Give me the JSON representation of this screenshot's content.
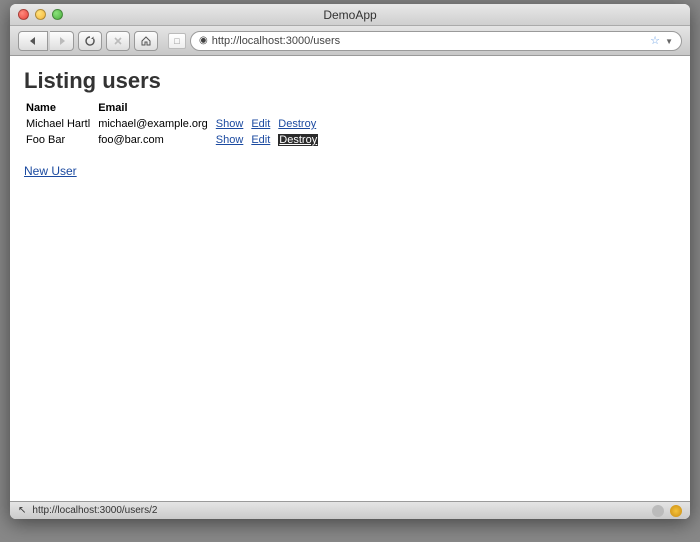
{
  "window": {
    "title": "DemoApp"
  },
  "toolbar": {
    "address": "http://localhost:3000/users"
  },
  "page": {
    "heading": "Listing users",
    "columns": {
      "name": "Name",
      "email": "Email"
    },
    "rows": [
      {
        "name": "Michael Hartl",
        "email": "michael@example.org",
        "show": "Show",
        "edit": "Edit",
        "destroy": "Destroy",
        "destroy_selected": false
      },
      {
        "name": "Foo Bar",
        "email": "foo@bar.com",
        "show": "Show",
        "edit": "Edit",
        "destroy": "Destroy",
        "destroy_selected": true
      }
    ],
    "new_user": "New User"
  },
  "status": {
    "url": "http://localhost:3000/users/2"
  }
}
